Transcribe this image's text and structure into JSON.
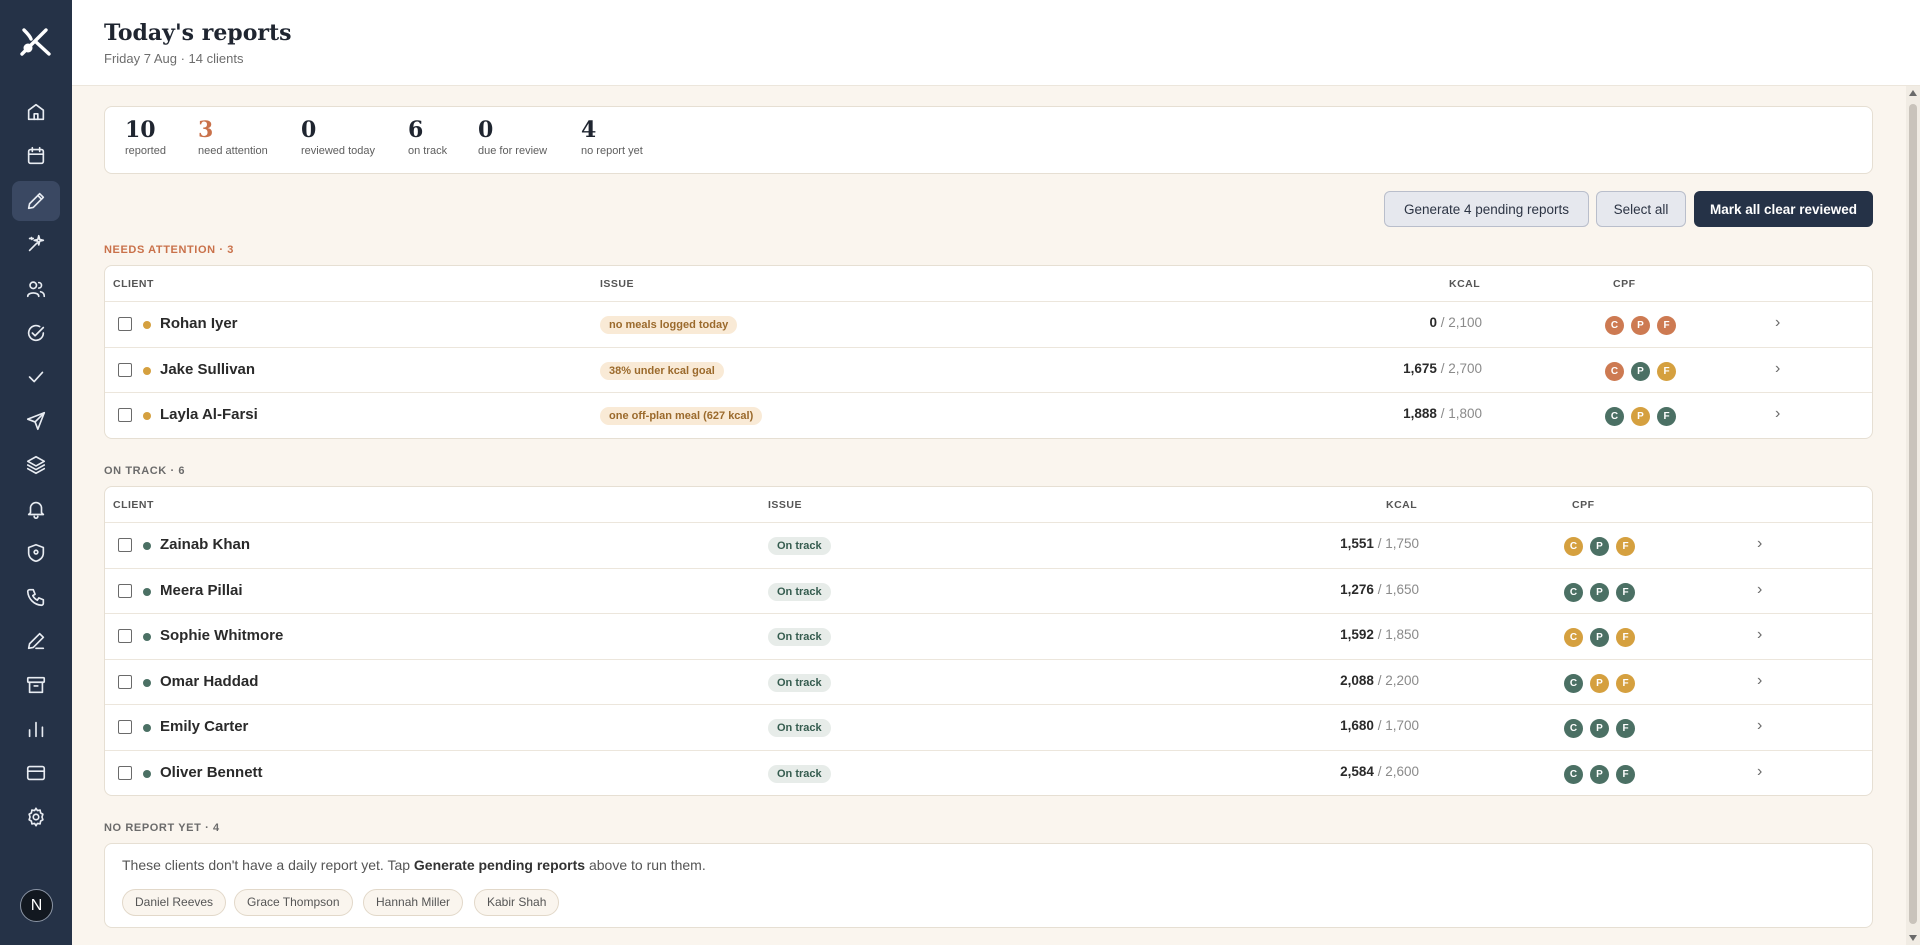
{
  "header": {
    "title": "Today's reports",
    "subtitle": "Friday 7 Aug · 14 clients"
  },
  "user": {
    "initial": "N"
  },
  "sidebar": {
    "items": [
      {
        "icon": "home-icon"
      },
      {
        "icon": "calendar-icon"
      },
      {
        "icon": "pencil-icon",
        "active": true
      },
      {
        "icon": "sparkle-icon"
      },
      {
        "icon": "users-icon"
      },
      {
        "icon": "check-circle-icon"
      },
      {
        "icon": "check-icon"
      },
      {
        "icon": "send-icon"
      },
      {
        "icon": "layers-icon"
      },
      {
        "icon": "bell-icon"
      },
      {
        "icon": "shield-icon"
      },
      {
        "icon": "phone-icon"
      },
      {
        "icon": "edit-icon"
      },
      {
        "icon": "archive-icon"
      },
      {
        "icon": "bar-chart-icon"
      },
      {
        "icon": "credit-card-icon"
      },
      {
        "icon": "gear-icon"
      }
    ]
  },
  "stats": [
    {
      "value": "10",
      "label": "reported"
    },
    {
      "value": "3",
      "label": "need attention"
    },
    {
      "value": "0",
      "label": "reviewed today"
    },
    {
      "value": "6",
      "label": "on track"
    },
    {
      "value": "0",
      "label": "due for review"
    },
    {
      "value": "4",
      "label": "no report yet"
    }
  ],
  "actions": {
    "generate": "Generate 4 pending reports",
    "select_all": "Select all",
    "mark_reviewed": "Mark all clear reviewed"
  },
  "columns": {
    "client": "CLIENT",
    "issue": "ISSUE",
    "kcal": "KCAL",
    "cpf": "CPF"
  },
  "needs_attention": {
    "title": "NEEDS ATTENTION · 3",
    "rows": [
      {
        "name": "Rohan Iyer",
        "issue": "no meals logged today",
        "kcal": "0",
        "goal": " / 2,100",
        "cpf": [
          "C",
          "P",
          "F"
        ],
        "cpf_colors": [
          "#cd7a52",
          "#cd7a52",
          "#cd7a52"
        ]
      },
      {
        "name": "Jake Sullivan",
        "issue": "38% under kcal goal",
        "kcal": "1,675",
        "goal": " / 2,700",
        "cpf": [
          "C",
          "P",
          "F"
        ],
        "cpf_colors": [
          "#cd7a52",
          "#4b7064",
          "#d5a03f"
        ]
      },
      {
        "name": "Layla Al-Farsi",
        "issue": "one off-plan meal (627 kcal)",
        "kcal": "1,888",
        "goal": " / 1,800",
        "cpf": [
          "C",
          "P",
          "F"
        ],
        "cpf_colors": [
          "#4b7064",
          "#d5a03f",
          "#4b7064"
        ]
      }
    ]
  },
  "on_track": {
    "title": "ON TRACK · 6",
    "rows": [
      {
        "name": "Zainab Khan",
        "issue": "On track",
        "kcal": "1,551",
        "goal": " / 1,750",
        "cpf": [
          "C",
          "P",
          "F"
        ],
        "cpf_colors": [
          "#d5a03f",
          "#4b7064",
          "#d5a03f"
        ]
      },
      {
        "name": "Meera Pillai",
        "issue": "On track",
        "kcal": "1,276",
        "goal": " / 1,650",
        "cpf": [
          "C",
          "P",
          "F"
        ],
        "cpf_colors": [
          "#4b7064",
          "#4b7064",
          "#4b7064"
        ]
      },
      {
        "name": "Sophie Whitmore",
        "issue": "On track",
        "kcal": "1,592",
        "goal": " / 1,850",
        "cpf": [
          "C",
          "P",
          "F"
        ],
        "cpf_colors": [
          "#d5a03f",
          "#4b7064",
          "#d5a03f"
        ]
      },
      {
        "name": "Omar Haddad",
        "issue": "On track",
        "kcal": "2,088",
        "goal": " / 2,200",
        "cpf": [
          "C",
          "P",
          "F"
        ],
        "cpf_colors": [
          "#4b7064",
          "#d5a03f",
          "#d5a03f"
        ]
      },
      {
        "name": "Emily Carter",
        "issue": "On track",
        "kcal": "1,680",
        "goal": " / 1,700",
        "cpf": [
          "C",
          "P",
          "F"
        ],
        "cpf_colors": [
          "#4b7064",
          "#4b7064",
          "#4b7064"
        ]
      },
      {
        "name": "Oliver Bennett",
        "issue": "On track",
        "kcal": "2,584",
        "goal": " / 2,600",
        "cpf": [
          "C",
          "P",
          "F"
        ],
        "cpf_colors": [
          "#4b7064",
          "#4b7064",
          "#4b7064"
        ]
      }
    ]
  },
  "no_report": {
    "title": "NO REPORT YET · 4",
    "text_before": "These clients don't have a daily report yet. Tap ",
    "text_bold": "Generate pending reports",
    "text_after": " above to run them.",
    "clients": [
      "Daniel Reeves",
      "Grace Thompson",
      "Hannah Miller",
      "Kabir Shah"
    ]
  },
  "colors": {
    "sidebar": "#253247",
    "attention_dot": "#d5a03f",
    "ok_dot": "#4b7064",
    "accent": "#c9714a"
  }
}
